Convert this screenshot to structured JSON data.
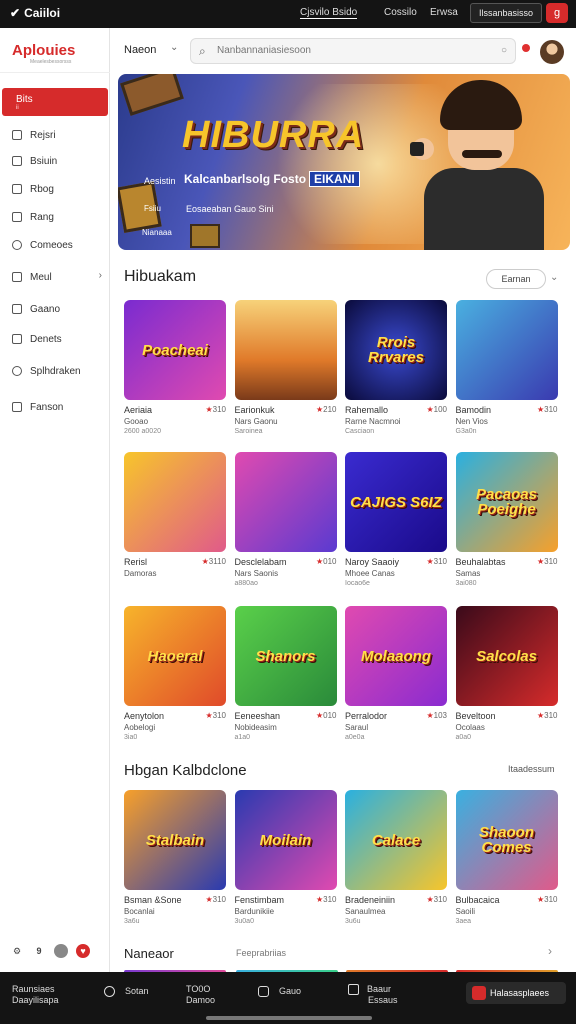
{
  "topbar": {
    "brand": "Caiiloi",
    "tab_active": "Cjsvilo  Bsido",
    "tab2": "Cossilo",
    "tab3": "Erwsa",
    "button": "Ilssanbasisso",
    "icon": "g"
  },
  "sidebar": {
    "logo": "Aplouies",
    "logo_sub": "Meaelesbessorsss",
    "items": [
      {
        "label": "Bits",
        "sub": "ii"
      },
      {
        "label": "Rejsri"
      },
      {
        "label": "Bsiuin"
      },
      {
        "label": "Rbog"
      },
      {
        "label": "Rang"
      },
      {
        "label": "Comeoes"
      },
      {
        "label": "Meul"
      },
      {
        "label": "Gaano"
      },
      {
        "label": "Denets"
      },
      {
        "label": "Splhdraken"
      },
      {
        "label": "Fanson"
      }
    ],
    "footer_icons": [
      "gear-icon",
      "help-icon",
      "moon-icon",
      "heart-icon"
    ]
  },
  "header": {
    "title": "Naeon",
    "search_placeholder": "Nanbannaniasiesoon"
  },
  "hero": {
    "title": "HIBURRA",
    "sub_label": "Aesistin",
    "subtitle": "Kalcanbarlsolg Fosto",
    "subtitle_tag": "EIKANI",
    "line2_label": "Fsiiu",
    "line2": "Eosaeaban Gauo Sini",
    "line3": "Nianaaa"
  },
  "section1": {
    "title": "Hibuakam",
    "sort_label": "Earnan"
  },
  "games": [
    {
      "art": "Poacheai",
      "title": "Aeriaia",
      "rating": "310",
      "meta": "Gooao",
      "date": "2600 a0020"
    },
    {
      "art": "",
      "title": "Earionkuk",
      "rating": "210",
      "meta": "Nars Gaonu",
      "date": "Saroinea"
    },
    {
      "art": "Rrois Rrvares",
      "title": "Rahemallo",
      "rating": "100",
      "meta": "Rarne Nacmnoi",
      "date": "Casciaon"
    },
    {
      "art": "",
      "title": "Bamodin",
      "rating": "310",
      "meta": "Nen Vios",
      "date": "G3a0n"
    },
    {
      "art": "",
      "title": "Rerisl",
      "rating": "3110",
      "meta": "Damoras",
      "date": ""
    },
    {
      "art": "",
      "title": "Desclelabam",
      "rating": "010",
      "meta": "Nars Saonis",
      "date": "a880ao"
    },
    {
      "art": "CAJIGS S6IZ",
      "title": "Naroy Saaoiy",
      "rating": "310",
      "meta": "Mhoee Canas",
      "date": "Iocao6e"
    },
    {
      "art": "Pacaoas Poeighe",
      "title": "Beuhalabtas",
      "rating": "310",
      "meta": "Samas",
      "date": "3ai080"
    },
    {
      "art": "Haoeral",
      "title": "Aenytolon",
      "rating": "310",
      "meta": "Aobelogi",
      "date": "3ia0"
    },
    {
      "art": "Shanors",
      "title": "Eeneeshan",
      "rating": "010",
      "meta": "Nobideasim",
      "date": "a1a0"
    },
    {
      "art": "Molaaong",
      "title": "Perralodor",
      "rating": "103",
      "meta": "Saraul",
      "date": "a0e0a"
    },
    {
      "art": "Salcolas",
      "title": "Beveltoon",
      "rating": "310",
      "meta": "Ocolaas",
      "date": "a0a0"
    }
  ],
  "section2": {
    "title": "Hbgan Kalbdclone",
    "see_all": "Itaadessum"
  },
  "games2": [
    {
      "art": "Stalbain",
      "title": "Bsman &Sone",
      "rating": "310",
      "meta": "Bocanlai",
      "date": "3a6u"
    },
    {
      "art": "Moilain",
      "title": "Fenstimbam",
      "rating": "310",
      "meta": "Bardunikiie",
      "date": "3u0a0"
    },
    {
      "art": "Calace",
      "title": "Bradeneiniin",
      "rating": "310",
      "meta": "Sanaulmea",
      "date": "3u6u"
    },
    {
      "art": "Shaoon Comes",
      "title": "Bulbacaica",
      "rating": "310",
      "meta": "Saoili",
      "date": "3aea"
    }
  ],
  "section3": {
    "title": "Naneaor",
    "sub": "Feeprabriias",
    "chevron": "›"
  },
  "bottombar": {
    "left1": "Raunsiaes",
    "left2": "Daayilisapa",
    "i1": "Sotan",
    "i2a": "TO0O",
    "i2b": "Damoo",
    "i3": "Gauo",
    "i4a": "Baaur",
    "i4b": "Essaus",
    "cta": "Halasasplaees"
  },
  "colors": {
    "accent": "#d62b2b",
    "dark": "#141414"
  }
}
